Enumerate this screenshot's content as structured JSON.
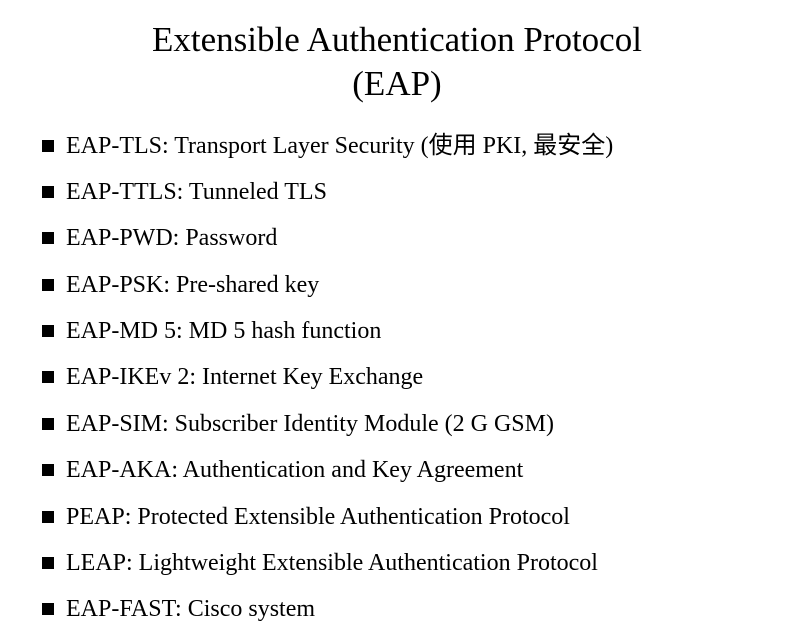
{
  "title_line1": "Extensible Authentication Protocol",
  "title_line2": "(EAP)",
  "bullets": [
    "EAP-TLS: Transport Layer Security (使用 PKI, 最安全)",
    "EAP-TTLS: Tunneled TLS",
    "EAP-PWD: Password",
    "EAP-PSK: Pre-shared key",
    "EAP-MD 5: MD 5 hash function",
    "EAP-IKEv 2:  Internet Key Exchange",
    "EAP-SIM:  Subscriber Identity Module  (2 G GSM)",
    "EAP-AKA: Authentication and Key Agreement",
    "PEAP: Protected Extensible Authentication Protocol",
    "LEAP: Lightweight Extensible Authentication Protocol",
    "EAP-FAST: Cisco system"
  ]
}
